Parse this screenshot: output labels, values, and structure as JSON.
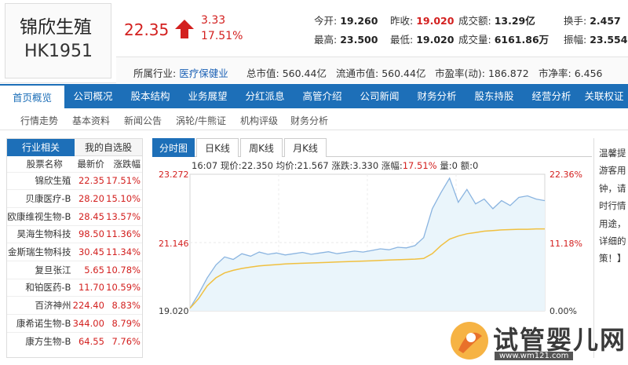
{
  "stock": {
    "name": "锦欣生殖",
    "code": "HK1951",
    "price": "22.35",
    "change": "3.33",
    "change_pct": "17.51%"
  },
  "stats": {
    "open_label": "今开:",
    "open": "19.260",
    "prev_close_label": "昨收:",
    "prev_close": "19.020",
    "amount_label": "成交额:",
    "amount": "13.29亿",
    "turnover_label": "换手:",
    "turnover": "2.457",
    "high_label": "最高:",
    "high": "23.500",
    "low_label": "最低:",
    "low": "19.020",
    "volume_label": "成交量:",
    "volume": "6161.86万",
    "amplitude_label": "振幅:",
    "amplitude": "23.554"
  },
  "info": {
    "industry_label": "所属行业:",
    "industry": "医疗保健业",
    "mktcap_label": "总市值:",
    "mktcap": "560.44亿",
    "float_label": "流通市值:",
    "float": "560.44亿",
    "pe_label": "市盈率(动):",
    "pe": "186.872",
    "pb_label": "市净率:",
    "pb": "6.456"
  },
  "nav": [
    "首页概览",
    "公司概况",
    "股本结构",
    "业务展望",
    "分红派息",
    "高管介绍",
    "公司新闻",
    "财务分析",
    "股东持股",
    "经营分析",
    "关联权证"
  ],
  "subnav": [
    "行情走势",
    "基本资料",
    "新闻公告",
    "涡轮/牛熊证",
    "机构评级",
    "财务分析"
  ],
  "left_panel": {
    "tab_related": "行业相关",
    "tab_watchlist": "我的自选股",
    "headers": [
      "股票名称",
      "最新价",
      "涨跌幅"
    ],
    "rows": [
      {
        "name": "锦欣生殖",
        "price": "22.35",
        "pct": "17.51%"
      },
      {
        "name": "贝康医疗-B",
        "price": "28.20",
        "pct": "15.10%"
      },
      {
        "name": "欧康维视生物-B",
        "price": "28.45",
        "pct": "13.57%"
      },
      {
        "name": "昊海生物科技",
        "price": "98.50",
        "pct": "11.36%"
      },
      {
        "name": "金斯瑞生物科技",
        "price": "30.45",
        "pct": "11.34%"
      },
      {
        "name": "复旦张江",
        "price": "5.65",
        "pct": "10.78%"
      },
      {
        "name": "和铂医药-B",
        "price": "11.70",
        "pct": "10.59%"
      },
      {
        "name": "百济神州",
        "price": "224.40",
        "pct": "8.83%"
      },
      {
        "name": "康希诺生物-B",
        "price": "344.00",
        "pct": "8.79%"
      },
      {
        "name": "康方生物-B",
        "price": "64.55",
        "pct": "7.76%"
      }
    ]
  },
  "chart_tabs": [
    "分时图",
    "日K线",
    "周K线",
    "月K线"
  ],
  "chart_info": {
    "time": "16:07",
    "now_label": "现价:",
    "now": "22.350",
    "avg_label": "均价:",
    "avg": "21.567",
    "chg_label": "涨跌:",
    "chg": "3.330",
    "pct_label": "涨幅:",
    "pct": "17.51%",
    "vol_label": "量:",
    "vol": "0",
    "amt_label": "额:",
    "amt": "0"
  },
  "chart_data": {
    "type": "line",
    "y_left_ticks": [
      "23.272",
      "21.146",
      "19.020"
    ],
    "y_right_ticks": [
      "22.36%",
      "11.18%",
      "0.00%"
    ],
    "ylim": [
      19.02,
      23.272
    ],
    "series": [
      {
        "name": "现价",
        "color": "#8ab4e0",
        "values": [
          19.1,
          19.55,
          20.05,
          20.45,
          20.7,
          20.62,
          20.8,
          20.72,
          20.85,
          20.78,
          20.82,
          20.76,
          20.8,
          20.84,
          20.78,
          20.82,
          20.86,
          20.8,
          20.84,
          20.88,
          20.85,
          20.9,
          20.95,
          20.92,
          21.0,
          20.98,
          21.05,
          21.3,
          22.2,
          22.7,
          23.15,
          22.4,
          22.8,
          22.35,
          22.5,
          22.2,
          22.45,
          22.3,
          22.55,
          22.6,
          22.5,
          22.45
        ]
      },
      {
        "name": "均价",
        "color": "#f0c040",
        "values": [
          19.1,
          19.4,
          19.8,
          20.05,
          20.2,
          20.28,
          20.34,
          20.38,
          20.42,
          20.44,
          20.46,
          20.48,
          20.49,
          20.5,
          20.51,
          20.52,
          20.53,
          20.54,
          20.55,
          20.56,
          20.57,
          20.58,
          20.59,
          20.6,
          20.61,
          20.62,
          20.63,
          20.65,
          20.8,
          21.05,
          21.25,
          21.35,
          21.42,
          21.46,
          21.5,
          21.52,
          21.54,
          21.55,
          21.56,
          21.56,
          21.57,
          21.57
        ]
      }
    ],
    "fill_color": "#eaf5fb",
    "grid": true
  },
  "right_panel": [
    "温馨提",
    "游客用",
    "钟，请",
    "时行情",
    "用途，",
    "详细的",
    "策！】"
  ],
  "watermark": {
    "text": "试管婴儿网",
    "url": "www.wm121.com"
  },
  "colors": {
    "accent": "#1d6fb8",
    "up": "#d3201f"
  }
}
